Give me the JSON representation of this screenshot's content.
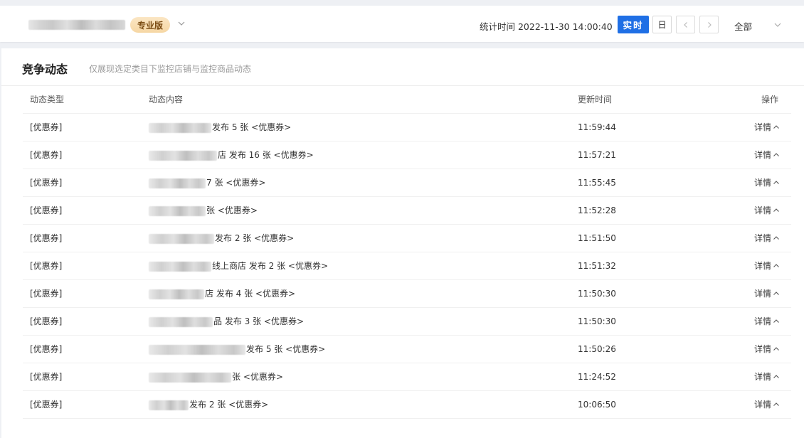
{
  "header": {
    "edition_badge": "专业版",
    "stat_time_label": "统计时间 2022-11-30 14:00:40",
    "realtime_button": "实时",
    "day_button": "日",
    "scope_select": "全部"
  },
  "panel": {
    "title": "竞争动态",
    "subtitle": "仅展现选定类目下监控店铺与监控商品动态"
  },
  "table": {
    "columns": [
      "动态类型",
      "动态内容",
      "更新时间",
      "操作"
    ],
    "rows": [
      {
        "type": "[优惠券]",
        "content": "发布 5 张 <优惠券>",
        "time": "11:59:44",
        "op": "详情"
      },
      {
        "type": "[优惠券]",
        "content": "店 发布 16 张 <优惠券>",
        "time": "11:57:21",
        "op": "详情"
      },
      {
        "type": "[优惠券]",
        "content": "7 张 <优惠券>",
        "time": "11:55:45",
        "op": "详情"
      },
      {
        "type": "[优惠券]",
        "content": "张 <优惠券>",
        "time": "11:52:28",
        "op": "详情"
      },
      {
        "type": "[优惠券]",
        "content": "发布 2 张 <优惠券>",
        "time": "11:51:50",
        "op": "详情"
      },
      {
        "type": "[优惠券]",
        "content": "线上商店 发布 2 张 <优惠券>",
        "time": "11:51:32",
        "op": "详情"
      },
      {
        "type": "[优惠券]",
        "content": "店 发布 4 张 <优惠券>",
        "time": "11:50:30",
        "op": "详情"
      },
      {
        "type": "[优惠券]",
        "content": "品 发布 3 张 <优惠券>",
        "time": "11:50:30",
        "op": "详情"
      },
      {
        "type": "[优惠券]",
        "content": "发布 5 张 <优惠券>",
        "time": "11:50:26",
        "op": "详情"
      },
      {
        "type": "[优惠券]",
        "content": "张 <优惠券>",
        "time": "11:24:52",
        "op": "详情"
      },
      {
        "type": "[优惠券]",
        "content": "发布 2 张 <优惠券>",
        "time": "10:06:50",
        "op": "详情"
      }
    ]
  },
  "colors": {
    "accent": "#1f6fe5",
    "badge_bg": "#f6d7a4",
    "badge_text": "#7a4b12",
    "page_bg": "#eef0f4"
  },
  "icons": {
    "shop_dropdown": "chevron-down-icon",
    "prev": "chevron-left-icon",
    "next": "chevron-right-icon",
    "scope_dropdown": "chevron-down-icon",
    "detail_toggle": "chevron-up-icon"
  }
}
